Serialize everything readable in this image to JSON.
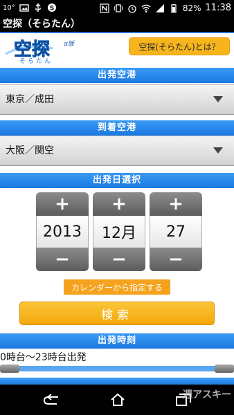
{
  "status": {
    "temperature": "10°",
    "battery": "82%",
    "time": "11:38"
  },
  "app": {
    "title": "空探（そらたん）"
  },
  "header": {
    "logo_text": "空探",
    "logo_sub": "そらたん",
    "logo_badge": "α版",
    "about_button": "空探(そらたん)とは？"
  },
  "departure": {
    "heading": "出発空港",
    "value": "東京／成田"
  },
  "arrival": {
    "heading": "到着空港",
    "value": "大阪／関空"
  },
  "date": {
    "heading": "出発日選択",
    "year": "2013",
    "month": "12月",
    "day": "27",
    "plus": "+",
    "minus": "−",
    "calendar_button": "カレンダーから指定する"
  },
  "search_button": "検索",
  "time_range": {
    "heading": "出発時刻",
    "text": "0時台～23時台出発",
    "min": 0,
    "max": 23
  },
  "watermark": "週アスキー",
  "colors": {
    "accent_blue": "#1a78e0",
    "orange": "#f5a21c"
  }
}
